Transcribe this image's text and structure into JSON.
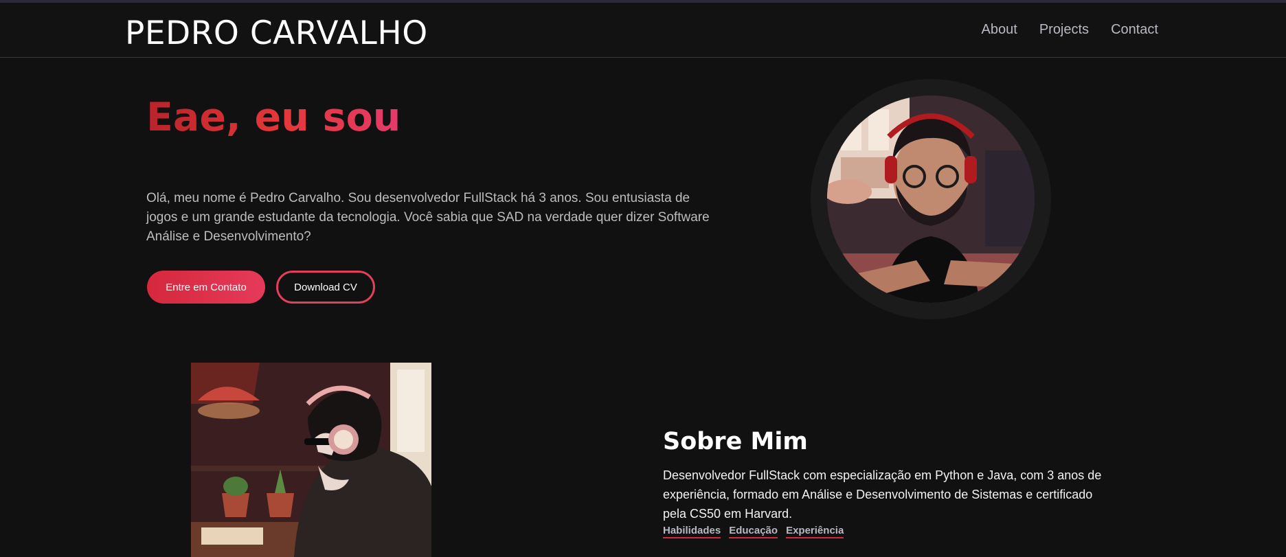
{
  "brand": "PEDRO CARVALHO",
  "nav": {
    "about": "About",
    "projects": "Projects",
    "contact": "Contact"
  },
  "hero": {
    "title": "Eae, eu sou",
    "text": "Olá, meu nome é Pedro Carvalho. Sou desenvolvedor FullStack há 3 anos. Sou entusiasta de jogos e um grande estudante da tecnologia. Você sabia que SAD na verdade quer dizer Software Análise e Desenvolvimento?",
    "primary_button": "Entre em Contato",
    "secondary_button": "Download CV"
  },
  "about": {
    "title": "Sobre Mim",
    "text": "Desenvolvedor FullStack com especialização em Python e Java, com 3 anos de experiência, formado em Análise e Desenvolvimento de Sistemas e certificado pela CS50 em Harvard.",
    "links": {
      "skills": "Habilidades",
      "education": "Educação",
      "experience": "Experiência"
    }
  },
  "colors": {
    "background": "#111111",
    "accent": "#e53a5a",
    "accent_dark": "#b9232b"
  }
}
